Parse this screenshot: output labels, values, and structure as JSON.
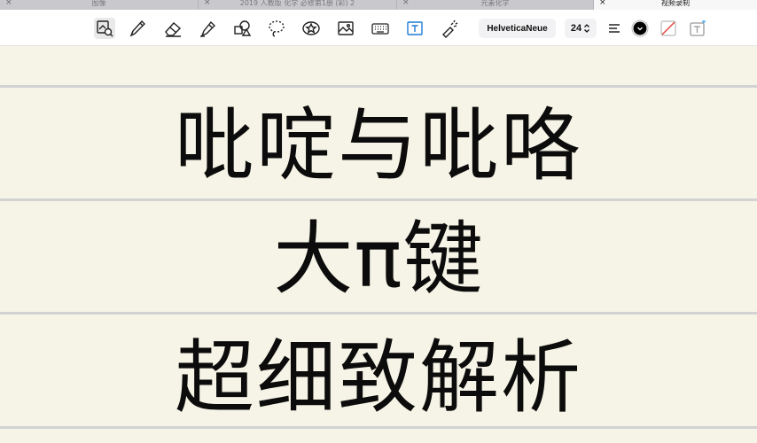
{
  "tabs": [
    {
      "label": "图像",
      "close": "×",
      "active": false
    },
    {
      "label": "2019 人教版 化学 必修第1册 (彩) 2",
      "close": "×",
      "active": false
    },
    {
      "label": "元素化学",
      "close": "×",
      "active": false
    },
    {
      "label": "视频录制",
      "close": "×",
      "active": true
    }
  ],
  "toolbar": {
    "tools": [
      {
        "icon": "zoom-select-icon",
        "selected": true
      },
      {
        "icon": "pen-icon"
      },
      {
        "icon": "eraser-icon"
      },
      {
        "icon": "highlighter-icon"
      },
      {
        "icon": "shapes-icon"
      },
      {
        "icon": "lasso-icon"
      },
      {
        "icon": "sticker-icon"
      },
      {
        "icon": "image-icon"
      },
      {
        "icon": "keyboard-icon"
      },
      {
        "icon": "text-box-icon"
      },
      {
        "icon": "laser-pointer-icon"
      }
    ],
    "font_name": "HelveticaNeue",
    "font_size": "24",
    "text_color": "#000000",
    "accent_color": "#1e7bd6",
    "badge_color": "#5ab4f0"
  },
  "content": {
    "line1": "吡啶与吡咯",
    "line2": "大π键",
    "line3": "超细致解析"
  }
}
